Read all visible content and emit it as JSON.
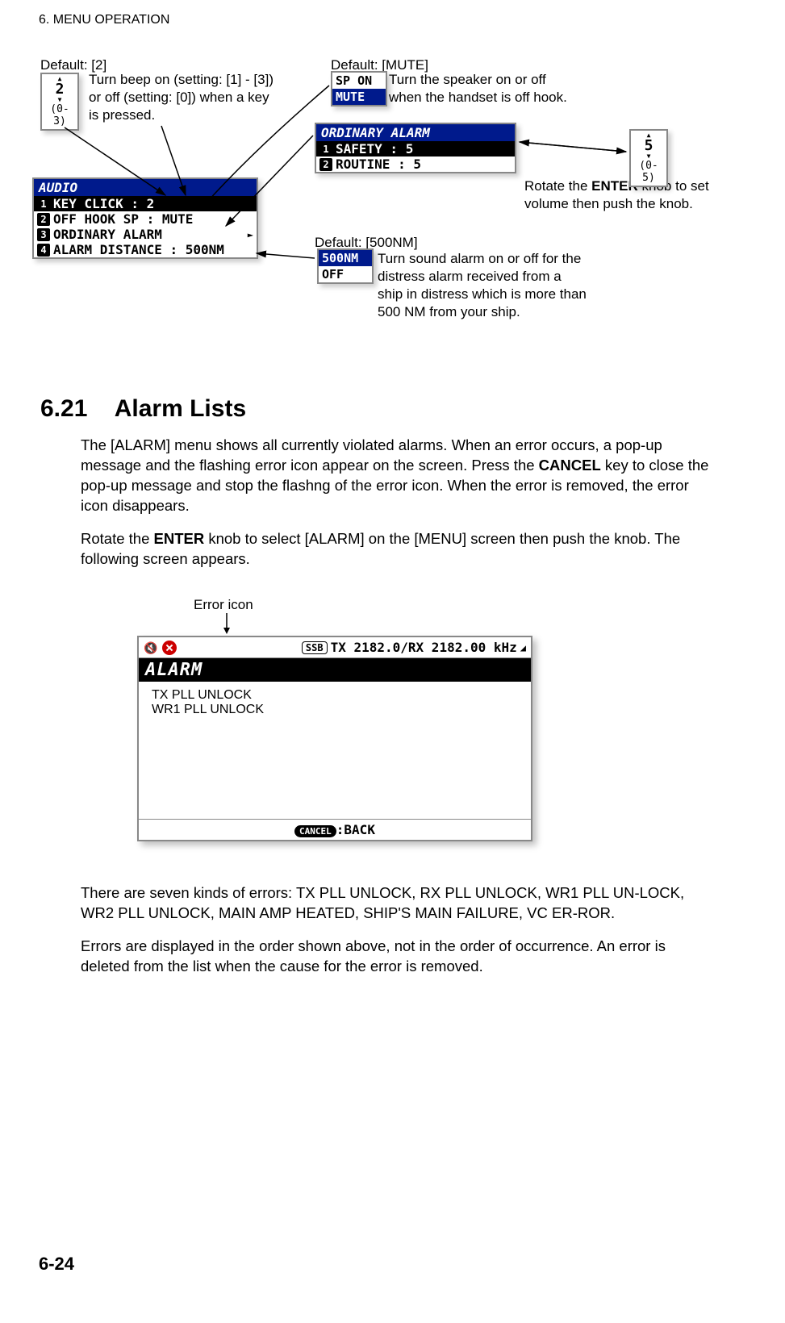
{
  "header": "6.  MENU OPERATION",
  "page_number": "6-24",
  "diagram": {
    "default_keyclick": "Default: [2]",
    "keyclick_desc": "Turn beep on (setting: [1] - [3]) or off (setting: [0]) when a key is pressed.",
    "default_mute": "Default: [MUTE]",
    "mute_desc": "Turn the speaker on or off when the handset is off hook.",
    "default_500nm": "Default: [500NM]",
    "dist_desc": "Turn sound alarm on or off for the distress alarm received from a ship in distress which is more than 500 NM from your ship.",
    "enter_knob_desc_1": "Rotate the ",
    "enter_knob_bold": "ENTER",
    "enter_knob_desc_2": " knob to set volume then push the knob.",
    "box_keyclick": {
      "value": "2",
      "range": "(0-3)"
    },
    "box_vol": {
      "value": "5",
      "range": "(0-5)"
    },
    "opt_sp": {
      "r1": "SP ON",
      "r2": "MUTE"
    },
    "opt_dist": {
      "r1": "500NM",
      "r2": "OFF"
    },
    "audio_menu": {
      "title": "AUDIO",
      "r1_num": "1",
      "r1": "KEY CLICK      : 2",
      "r2_num": "2",
      "r2": "OFF HOOK SP    : MUTE",
      "r3_num": "3",
      "r3": "ORDINARY ALARM",
      "r4_num": "4",
      "r4": "ALARM DISTANCE : 500NM"
    },
    "ord_menu": {
      "title": "ORDINARY ALARM",
      "r1_num": "1",
      "r1": "SAFETY      : 5",
      "r2_num": "2",
      "r2": "ROUTINE     : 5"
    }
  },
  "section": {
    "num": "6.21",
    "title": "Alarm Lists",
    "p1a": "The [ALARM] menu shows all currently violated alarms. When an error occurs, a pop-up message and the flashing error icon appear on the screen. Press the ",
    "p1bold": "CANCEL",
    "p1b": " key to close the pop-up message and stop the flashng of the error icon. When the error is removed, the error icon disappears.",
    "p2a": "Rotate the ",
    "p2bold": "ENTER",
    "p2b": " knob to select [ALARM] on the [MENU] screen then push the knob. The following screen appears.",
    "error_icon_label": "Error icon",
    "alarm_screen": {
      "ssb": "SSB",
      "freq": "TX 2182.0/RX 2182.00 kHz",
      "title": "ALARM",
      "line1": "TX PLL UNLOCK",
      "line2": "WR1 PLL UNLOCK",
      "cancel": "CANCEL",
      "back": ":BACK"
    },
    "p3": "There are seven kinds of errors: TX PLL UNLOCK, RX PLL UNLOCK, WR1 PLL UN-LOCK, WR2 PLL UNLOCK, MAIN AMP HEATED, SHIP'S MAIN FAILURE, VC ER-ROR.",
    "p4": "Errors are displayed in the order shown above, not in the order of occurrence. An error is deleted from the list when the cause for the error is removed."
  }
}
